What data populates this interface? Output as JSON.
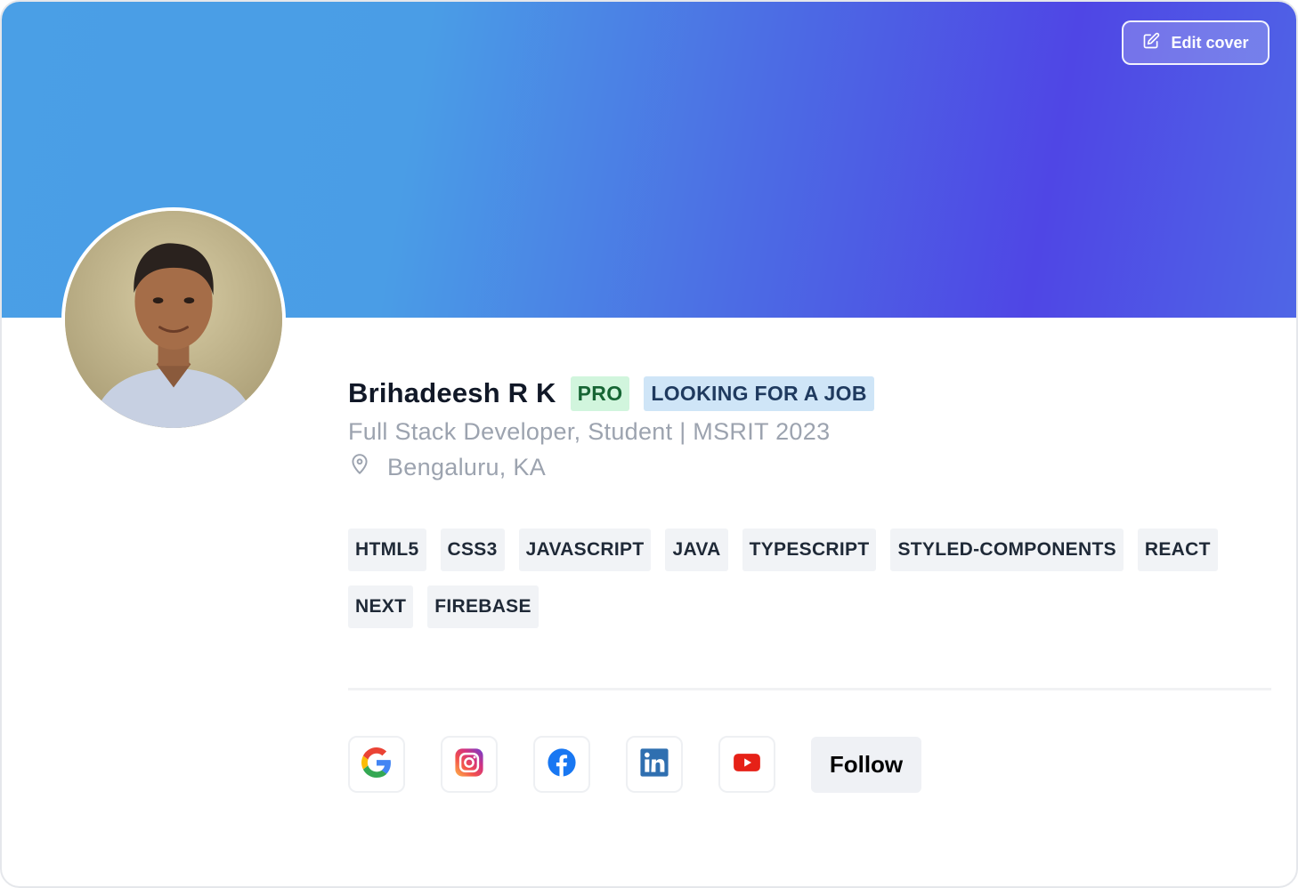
{
  "cover": {
    "edit_label": "Edit cover",
    "edit_icon": "pencil-square-icon"
  },
  "profile": {
    "avatar_icon": "person-photo",
    "name": "Brihadeesh R K",
    "badges": [
      "PRO",
      "LOOKING FOR A JOB"
    ],
    "headline": "Full Stack Developer, Student | MSRIT 2023",
    "location_icon": "map-pin-icon",
    "location": "Bengaluru, KA"
  },
  "skills": [
    "HTML5",
    "CSS3",
    "JAVASCRIPT",
    "JAVA",
    "TYPESCRIPT",
    "STYLED-COMPONENTS",
    "REACT",
    "NEXT",
    "FIREBASE"
  ],
  "social": {
    "links": [
      {
        "name": "google",
        "icon": "google-icon"
      },
      {
        "name": "instagram",
        "icon": "instagram-icon"
      },
      {
        "name": "facebook",
        "icon": "facebook-icon"
      },
      {
        "name": "linkedin",
        "icon": "linkedin-icon"
      },
      {
        "name": "youtube",
        "icon": "youtube-icon"
      }
    ],
    "follow_label": "Follow"
  },
  "colors": {
    "cover_gradient": [
      "#4a9fe6",
      "#4f46e5"
    ],
    "pro_badge_bg": "#d1f5dd",
    "job_badge_bg": "#cfe5f7",
    "skill_bg": "#f1f3f6"
  }
}
